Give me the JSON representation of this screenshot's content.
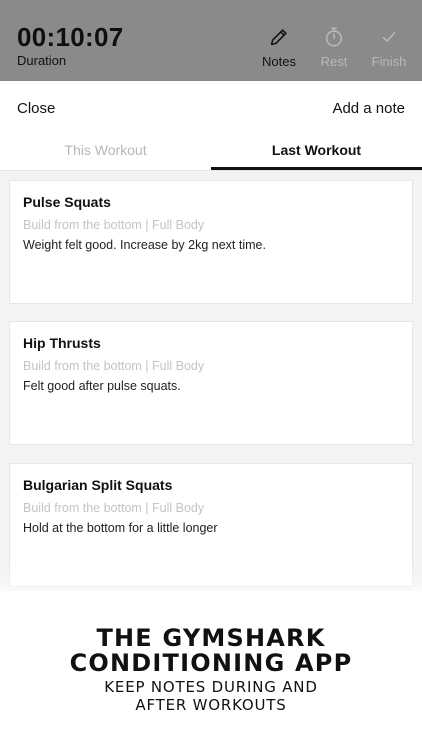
{
  "header": {
    "timer": "00:10:07",
    "timer_label": "Duration",
    "actions": [
      {
        "label": "Notes",
        "icon": "pencil-icon",
        "enabled": true
      },
      {
        "label": "Rest",
        "icon": "stopwatch-icon",
        "enabled": false
      },
      {
        "label": "Finish",
        "icon": "checkmark-icon",
        "enabled": false
      }
    ]
  },
  "sheet": {
    "close_label": "Close",
    "add_note_label": "Add a note",
    "tabs": [
      {
        "label": "This Workout",
        "active": false
      },
      {
        "label": "Last Workout",
        "active": true
      }
    ],
    "notes": [
      {
        "exercise": "Pulse Squats",
        "meta": "Build from the bottom | Full Body",
        "text": "Weight felt good. Increase by 2kg next time."
      },
      {
        "exercise": "Hip Thrusts",
        "meta": "Build from the bottom | Full Body",
        "text": "Felt good after pulse squats."
      },
      {
        "exercise": "Bulgarian Split Squats",
        "meta": "Build from the bottom | Full Body",
        "text": "Hold at the bottom for a little longer"
      }
    ]
  },
  "promo": {
    "title_line1": "THE GYMSHARK",
    "title_line2": "CONDITIONING APP",
    "subtitle_line1": "KEEP NOTES DURING AND",
    "subtitle_line2": "AFTER WORKOUTS"
  }
}
